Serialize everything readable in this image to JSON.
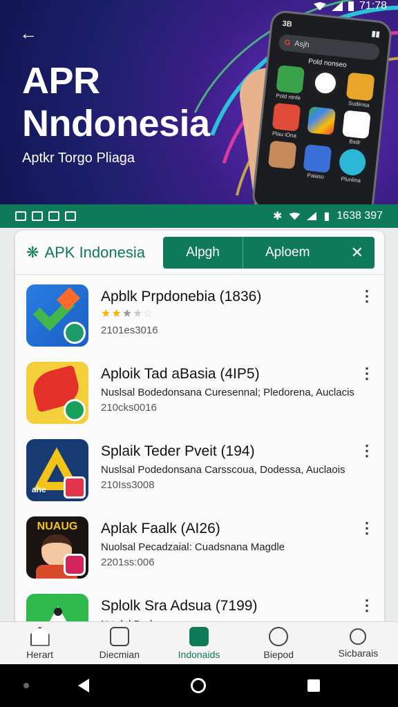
{
  "status_top": {
    "time": "71:78"
  },
  "hero": {
    "title_line1": "APR",
    "title_line2": "Nndonesia",
    "subtitle": "Aptkr Torgo Pliaga",
    "phone": {
      "status": "3B",
      "search_text": "Asjh",
      "label": "Pold nonseo",
      "apps": [
        "Pold ntnfe",
        "",
        "Sudiinsa",
        "Plau iOna",
        "",
        "Bsdr",
        "",
        "Paiaso",
        "Plunlina"
      ]
    }
  },
  "status_bar": {
    "right_text": "1638 397"
  },
  "header": {
    "brand": "APK Indonesia",
    "segment_left": "Alpgh",
    "segment_right": "Aploem",
    "close_icon": "close-icon"
  },
  "apps": [
    {
      "title": "Apblk Prpdonebia (1836)",
      "desc": "",
      "meta": "2101es3016",
      "rating": 2.5
    },
    {
      "title": "Aploik Tad aBasia (4IP5)",
      "desc": "Nuslsal Bodedonsana Curesennal; Pledorena, Auclacis",
      "meta": "210cks0016"
    },
    {
      "title": "Splaik Teder Pveit (194)",
      "desc": "Nuslsal Podedonsana Carsscoua, Dodessa, Auclaois",
      "meta": "210Iss3008",
      "icon_text": "ahe"
    },
    {
      "title": "Aplak  Faalk (AI26)",
      "desc": "Nuolsal Pecadzaial: Cuadsnana Magdle",
      "meta": "2201ss:006",
      "icon_text": "NUAUG"
    },
    {
      "title": "Splolk Sra Adsua (7199)",
      "desc": "Nrtolpl Bedenennnna",
      "meta": ""
    }
  ],
  "bottom_nav": [
    {
      "label": "Herart",
      "icon": "home-icon"
    },
    {
      "label": "Diecmian",
      "icon": "camera-icon"
    },
    {
      "label": "Indonaids",
      "icon": "leaf-icon",
      "active": true
    },
    {
      "label": "Biepod",
      "icon": "user-icon"
    },
    {
      "label": "Sicbarais",
      "icon": "search-icon"
    }
  ],
  "colors": {
    "brand_green": "#0e7a5a",
    "hero_bg": "#1a1f6a"
  }
}
